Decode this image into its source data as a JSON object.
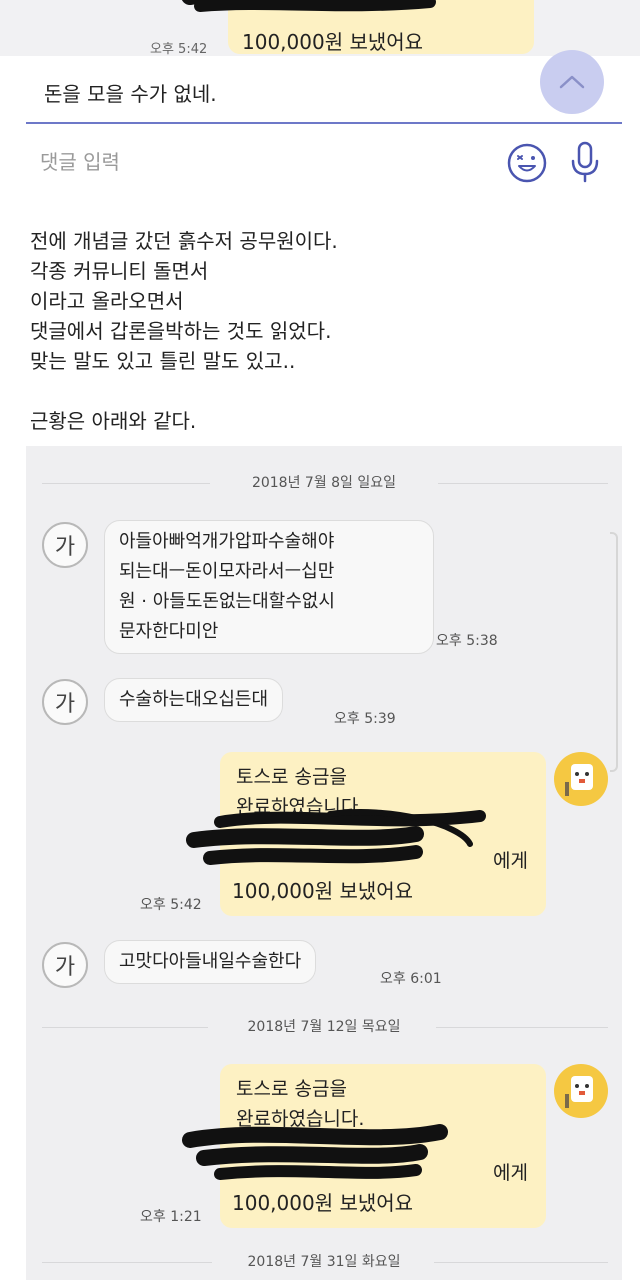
{
  "top_snippet": {
    "time": "오후 5:42",
    "amount_text": "100,000원 보냈어요"
  },
  "comment": {
    "text": "돈을 모을 수가 없네.",
    "input_placeholder": "댓글 입력"
  },
  "post": {
    "lines": [
      "전에 개념글 갔던 흙수저 공무원이다.",
      "각종 커뮤니티 돌면서",
      "이라고 올라오면서",
      "댓글에서 갑론을박하는 것도 읽었다.",
      "맞는 말도 있고 틀린 말도 있고..",
      "",
      "근황은 아래와 같다."
    ]
  },
  "chat": {
    "dates": [
      "2018년 7월 8일 일요일",
      "2018년 7월 12일 목요일",
      "2018년 7월 31일 화요일"
    ],
    "avatar_char": "가",
    "messages": [
      {
        "text": "아들아빠억개가압파수술해야\n되는대ㅡ돈이모자라서ㅡ십만\n원 · 아들도돈없는대할수없시\n문자한다미안",
        "time": "오후 5:38"
      },
      {
        "text": "수술하는대오십든대",
        "time": "오후 5:39"
      },
      {
        "text": "고맛다아들내일수술한다",
        "time": "오후 6:01"
      }
    ],
    "transfers": [
      {
        "line1": "토스로 송금을",
        "line2": "완료하였습니다.",
        "line3": "에게",
        "amount": "100,000원 보냈어요",
        "time": "오후 5:42"
      },
      {
        "line1": "토스로 송금을",
        "line2": "완료하였습니다.",
        "line3": "에게",
        "amount": "100,000원 보냈어요",
        "time": "오후 1:21"
      }
    ]
  },
  "colors": {
    "accent": "#6d78c8",
    "up_button": "#c9cdf0",
    "outgoing_bubble": "#fdf1c3",
    "incoming_bubble": "#f8f8f8",
    "chat_background": "#efeff1",
    "redaction": "#111111"
  },
  "icons": [
    "chevron-up-icon",
    "emoji-icon",
    "mic-icon",
    "toss-avatar-icon"
  ]
}
